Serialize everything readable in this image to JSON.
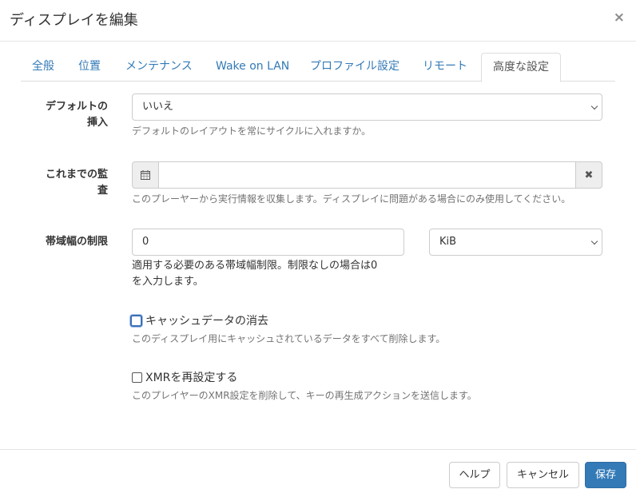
{
  "modal": {
    "title": "ディスプレイを編集",
    "close": "×"
  },
  "tabs": [
    "全般",
    "位置",
    "メンテナンス",
    "Wake on LAN",
    "プロファイル設定",
    "リモート",
    "高度な設定"
  ],
  "active_tab": "高度な設定",
  "fields": {
    "default_insert": {
      "label_line1": "デフォルトの",
      "label_line2": "挿入",
      "value": "いいえ",
      "help": "デフォルトのレイアウトを常にサイクルに入れますか。"
    },
    "audit_until": {
      "label_line1": "これまでの監",
      "label_line2": "査",
      "value": "",
      "calendar_icon": "calendar-icon",
      "clear_icon": "times-icon",
      "help": "このプレーヤーから実行情報を収集します。ディスプレイに問題がある場合にのみ使用してください。"
    },
    "bandwidth": {
      "label": "帯域幅の制限",
      "value": "0",
      "unit": "KiB",
      "help_line1": "適用する必要のある帯域幅制限。制限なしの場合は0",
      "help_line2": "を入力します。"
    },
    "clear_cache": {
      "label": "キャッシュデータの消去",
      "checked": false,
      "help": "このディスプレイ用にキャッシュされているデータをすべて削除します。"
    },
    "reset_xmr": {
      "label": "XMRを再設定する",
      "checked": false,
      "help": "このプレイヤーのXMR設定を削除して、キーの再生成アクションを送信します。"
    }
  },
  "footer": {
    "help": "ヘルプ",
    "cancel": "キャンセル",
    "save": "保存"
  },
  "colors": {
    "accent": "#337ab7",
    "border": "#cccccc",
    "help_text": "#737373"
  }
}
